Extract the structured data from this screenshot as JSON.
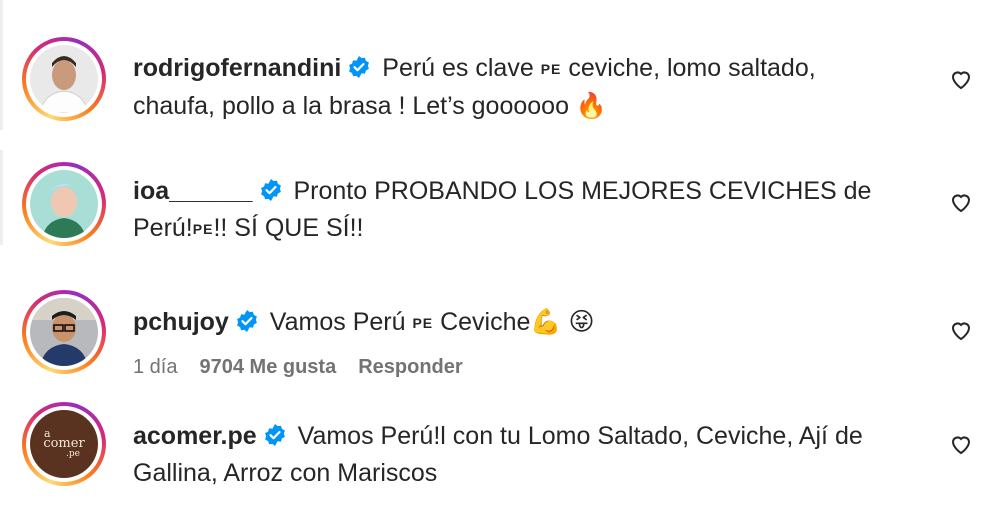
{
  "comments": [
    {
      "username": "rodrigofernandini",
      "text_a": " Perú es clave ",
      "flag": "PE",
      "text_b": " ceviche, lomo saltado, chaufa, pollo a la brasa ! Let’s goooooo ",
      "emoji": "🔥",
      "avatar": "chef-portrait"
    },
    {
      "username": "ioa______",
      "text_a": " Pronto PROBANDO LOS MEJORES CEVICHES de Perú!",
      "flag": "PE",
      "text_b": "!! SÍ QUE SÍ!!",
      "avatar": "illustrated-portrait"
    },
    {
      "username": "pchujoy",
      "text_a": " Vamos Perú ",
      "flag": "PE",
      "text_b": " Ceviche",
      "emoji": "💪 😝",
      "time": "1 día",
      "likes": "9704 Me gusta",
      "reply": "Responder",
      "avatar": "man-with-glasses"
    },
    {
      "username": "acomer.pe",
      "text_a": " Vamos Perú!l con tu Lomo Saltado, Ceviche, Ají de Gallina, Arroz con Mariscos",
      "avatar_text_top": "a",
      "avatar_text_mid": "comer",
      "avatar_text_bot": ".pe"
    }
  ],
  "icons": {
    "heart": "heart-outline-icon",
    "verified": "verified-badge-icon"
  },
  "colors": {
    "verified": "#0095f6",
    "muted": "#737373",
    "brand_brown": "#5a3320"
  }
}
